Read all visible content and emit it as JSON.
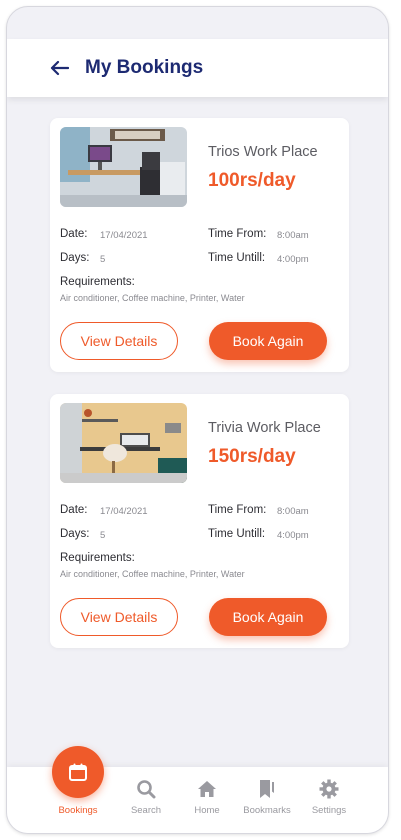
{
  "header": {
    "title": "My Bookings"
  },
  "bookings": [
    {
      "place": "Trios Work Place",
      "price": "100rs/day",
      "date_label": "Date:",
      "date": "17/04/2021",
      "days_label": "Days:",
      "days": "5",
      "time_from_label": "Time From:",
      "time_from": "8:00am",
      "time_until_label": "Time Untill:",
      "time_until": "4:00pm",
      "requirements_label": "Requirements:",
      "requirements": "Air conditioner, Coffee machine,  Printer, Water",
      "view_label": "View Details",
      "book_label": "Book Again"
    },
    {
      "place": "Trivia Work Place",
      "price": "150rs/day",
      "date_label": "Date:",
      "date": "17/04/2021",
      "days_label": "Days:",
      "days": "5",
      "time_from_label": "Time From:",
      "time_from": "8:00am",
      "time_until_label": "Time Untill:",
      "time_until": "4:00pm",
      "requirements_label": "Requirements:",
      "requirements": "Air conditioner, Coffee machine,  Printer, Water",
      "view_label": "View Details",
      "book_label": "Book Again"
    }
  ],
  "nav": {
    "active": "Bookings",
    "items": [
      {
        "label": "Bookings",
        "icon": "calendar-icon"
      },
      {
        "label": "Search",
        "icon": "search-icon"
      },
      {
        "label": "Home",
        "icon": "home-icon"
      },
      {
        "label": "Bookmarks",
        "icon": "bookmark-icon"
      },
      {
        "label": "Settings",
        "icon": "gear-icon"
      }
    ]
  },
  "colors": {
    "accent": "#ef5a2a",
    "title": "#1d2a72",
    "background": "#f1f1f6"
  }
}
